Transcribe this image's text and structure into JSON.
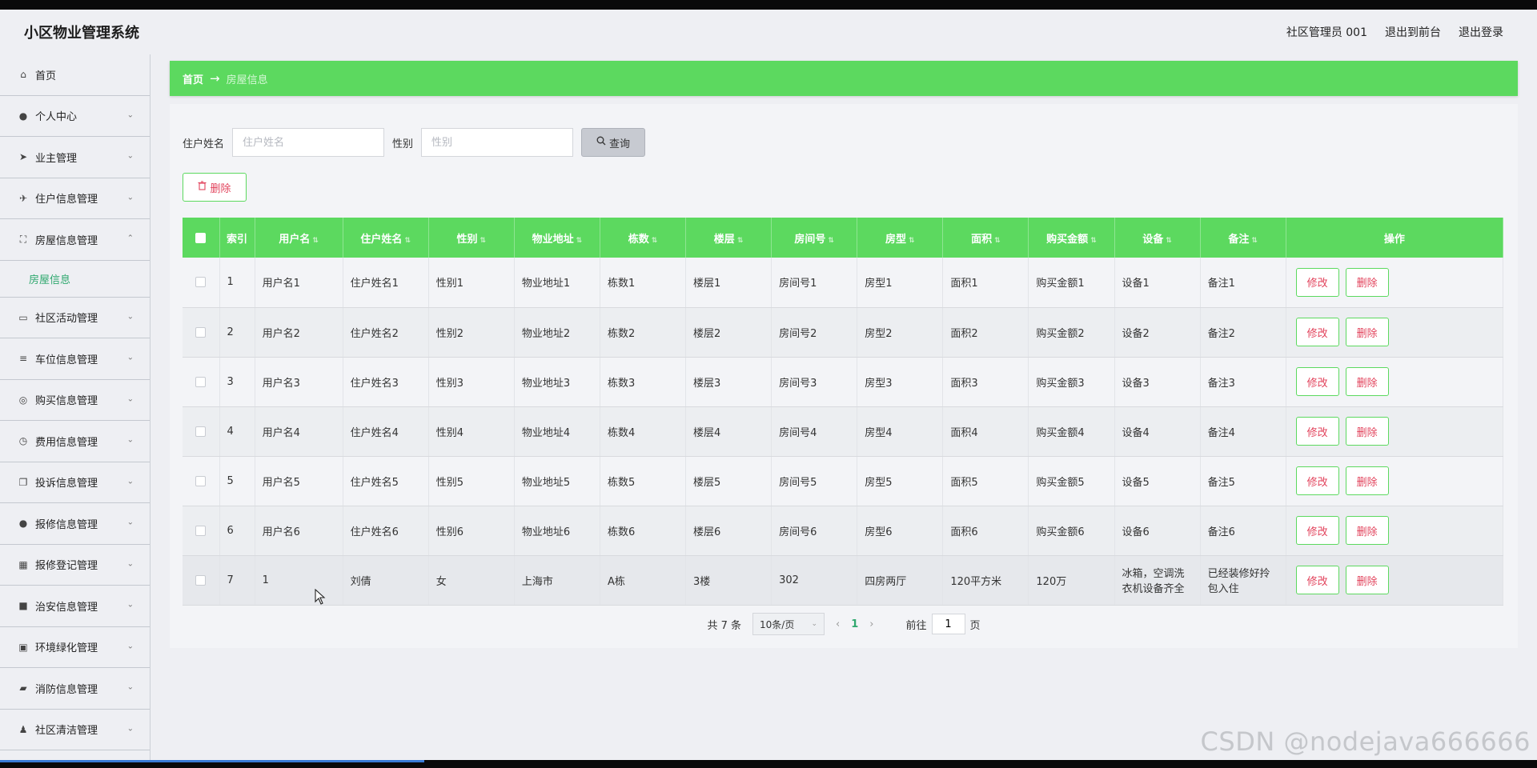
{
  "header": {
    "app_title": "小区物业管理系统",
    "user": "社区管理员 001",
    "back_front": "退出到前台",
    "logout": "退出登录"
  },
  "sidebar": {
    "items": [
      {
        "label": "首页",
        "icon": "home-icon",
        "glyph": "⌂",
        "chev": ""
      },
      {
        "label": "个人中心",
        "icon": "user-icon",
        "glyph": "●",
        "chev": "⌄"
      },
      {
        "label": "业主管理",
        "icon": "send-icon",
        "glyph": "➤",
        "chev": "⌄"
      },
      {
        "label": "住户信息管理",
        "icon": "paper-plane-icon",
        "glyph": "✈",
        "chev": "⌄"
      },
      {
        "label": "房屋信息管理",
        "icon": "fullscreen-icon",
        "glyph": "⛶",
        "chev": "⌃"
      }
    ],
    "sub_item": "房屋信息",
    "items_after": [
      {
        "label": "社区活动管理",
        "icon": "chat-icon",
        "glyph": "▭",
        "chev": "⌄"
      },
      {
        "label": "车位信息管理",
        "icon": "list-icon",
        "glyph": "≡",
        "chev": "⌄"
      },
      {
        "label": "购买信息管理",
        "icon": "coin-icon",
        "glyph": "◎",
        "chev": "⌄"
      },
      {
        "label": "费用信息管理",
        "icon": "clock-icon",
        "glyph": "◷",
        "chev": "⌄"
      },
      {
        "label": "投诉信息管理",
        "icon": "copy-icon",
        "glyph": "❐",
        "chev": "⌄"
      },
      {
        "label": "报修信息管理",
        "icon": "person-icon",
        "glyph": "●",
        "chev": "⌄"
      },
      {
        "label": "报修登记管理",
        "icon": "grid-icon",
        "glyph": "▦",
        "chev": "⌄"
      },
      {
        "label": "治安信息管理",
        "icon": "comment-icon",
        "glyph": "■",
        "chev": "⌄"
      },
      {
        "label": "环境绿化管理",
        "icon": "clipboard-icon",
        "glyph": "▣",
        "chev": "⌄"
      },
      {
        "label": "消防信息管理",
        "icon": "briefcase-icon",
        "glyph": "▰",
        "chev": "⌄"
      },
      {
        "label": "社区清洁管理",
        "icon": "person-icon",
        "glyph": "♟",
        "chev": "⌄"
      }
    ]
  },
  "breadcrumb": {
    "home": "首页",
    "arrow": "→",
    "current": "房屋信息"
  },
  "search": {
    "name_label": "住户姓名",
    "name_placeholder": "住户姓名",
    "gender_label": "性别",
    "gender_placeholder": "性别",
    "query_button": "查询"
  },
  "toolbar": {
    "delete_button": "删除"
  },
  "table": {
    "columns": [
      "索引",
      "用户名",
      "住户姓名",
      "性别",
      "物业地址",
      "栋数",
      "楼层",
      "房间号",
      "房型",
      "面积",
      "购买金额",
      "设备",
      "备注",
      "操作"
    ],
    "rows": [
      [
        "1",
        "用户名1",
        "住户姓名1",
        "性别1",
        "物业地址1",
        "栋数1",
        "楼层1",
        "房间号1",
        "房型1",
        "面积1",
        "购买金额1",
        "设备1",
        "备注1"
      ],
      [
        "2",
        "用户名2",
        "住户姓名2",
        "性别2",
        "物业地址2",
        "栋数2",
        "楼层2",
        "房间号2",
        "房型2",
        "面积2",
        "购买金额2",
        "设备2",
        "备注2"
      ],
      [
        "3",
        "用户名3",
        "住户姓名3",
        "性别3",
        "物业地址3",
        "栋数3",
        "楼层3",
        "房间号3",
        "房型3",
        "面积3",
        "购买金额3",
        "设备3",
        "备注3"
      ],
      [
        "4",
        "用户名4",
        "住户姓名4",
        "性别4",
        "物业地址4",
        "栋数4",
        "楼层4",
        "房间号4",
        "房型4",
        "面积4",
        "购买金额4",
        "设备4",
        "备注4"
      ],
      [
        "5",
        "用户名5",
        "住户姓名5",
        "性别5",
        "物业地址5",
        "栋数5",
        "楼层5",
        "房间号5",
        "房型5",
        "面积5",
        "购买金额5",
        "设备5",
        "备注5"
      ],
      [
        "6",
        "用户名6",
        "住户姓名6",
        "性别6",
        "物业地址6",
        "栋数6",
        "楼层6",
        "房间号6",
        "房型6",
        "面积6",
        "购买金额6",
        "设备6",
        "备注6"
      ],
      [
        "7",
        "1",
        "刘倩",
        "女",
        "上海市",
        "A栋",
        "3楼",
        "302",
        "四房两厅",
        "120平方米",
        "120万",
        "冰箱，空调洗衣机设备齐全",
        "已经装修好拎包入住"
      ]
    ],
    "edit_label": "修改",
    "delete_label": "删除"
  },
  "pagination": {
    "total": "共 7 条",
    "page_size": "10条/页",
    "current_page": "1",
    "goto_prefix": "前往",
    "goto_value": "1",
    "goto_suffix": "页"
  },
  "watermark": "CSDN @nodejava666666",
  "colors": {
    "accent_green": "#5cd95f",
    "danger_text": "#e2435c",
    "active_sub": "#2fa86e"
  }
}
